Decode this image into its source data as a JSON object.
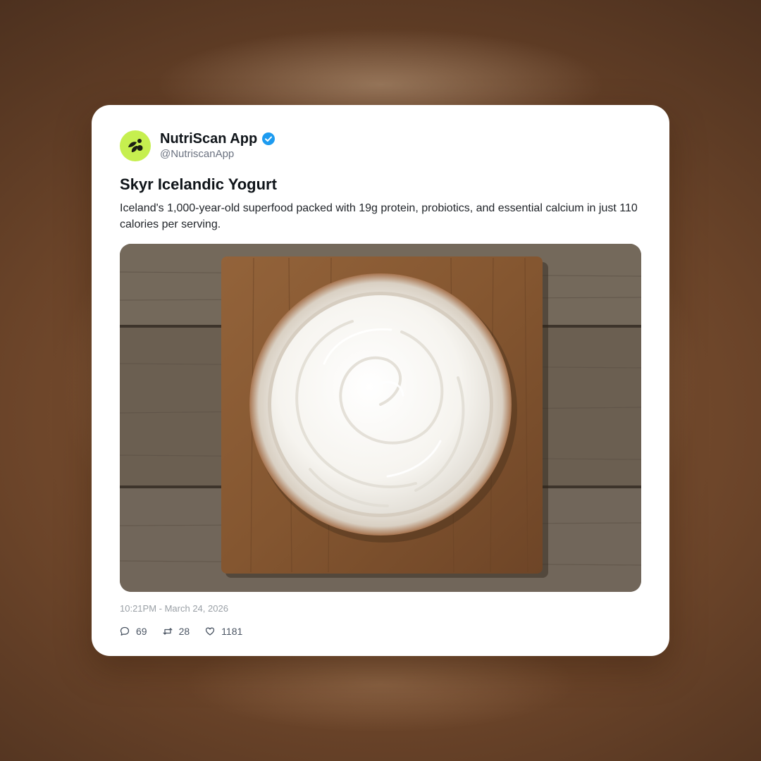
{
  "account": {
    "display_name": "NutriScan App",
    "handle": "@NutriscanApp",
    "verified": true,
    "avatar_icon": "leaf-logo-icon",
    "brand_color": "#c6ef4f",
    "verified_color": "#1d9bf0"
  },
  "post": {
    "title": "Skyr Icelandic Yogurt",
    "description": "Iceland's 1,000-year-old superfood packed with 19g protein, probiotics, and essential calcium in just 110 calories per serving.",
    "image_icon": "yogurt-bowl-on-wooden-board-photo",
    "timestamp": "10:21PM - March 24, 2026"
  },
  "stats": {
    "replies": "69",
    "reposts": "28",
    "likes": "1181"
  }
}
